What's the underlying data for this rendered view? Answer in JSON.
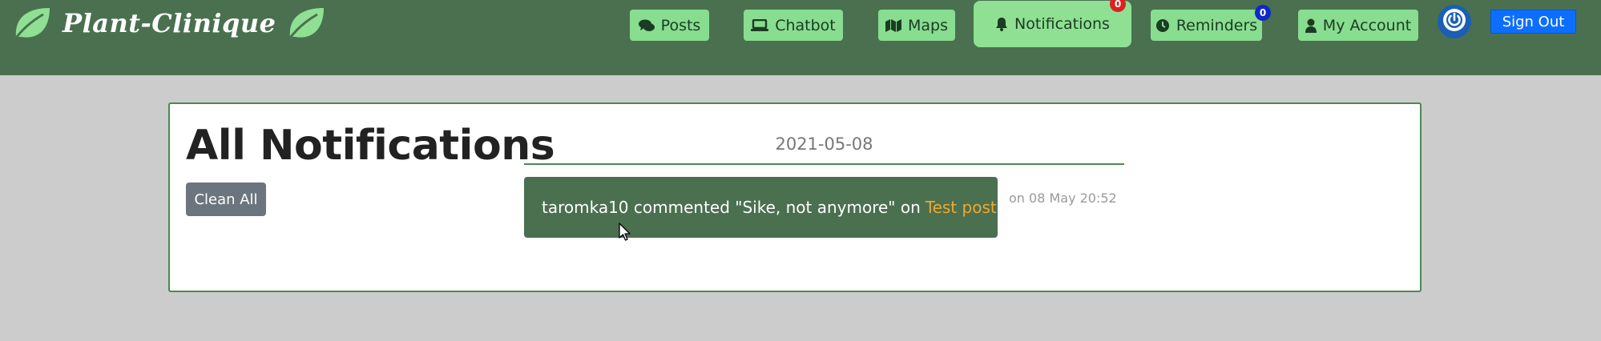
{
  "brand": {
    "name": "Plant-Clinique",
    "icons": [
      "leaf-icon",
      "leaf-icon"
    ]
  },
  "nav": {
    "posts": {
      "label": "Posts",
      "icon": "comments-icon"
    },
    "chatbot": {
      "label": "Chatbot",
      "icon": "laptop-icon"
    },
    "maps": {
      "label": "Maps",
      "icon": "map-icon"
    },
    "notifications": {
      "label": "Notifications",
      "icon": "bell-icon",
      "badge": "0"
    },
    "reminders": {
      "label": "Reminders",
      "icon": "clock-icon",
      "badge": "0"
    },
    "account": {
      "label": "My Account",
      "icon": "user-icon"
    },
    "power_icon": "power-icon",
    "sign_out": "Sign Out"
  },
  "page": {
    "title": "All Notifications",
    "clean_all": "Clean All"
  },
  "notifications": [
    {
      "date": "2021-05-08",
      "text": "taromka10 commented \"Sike, not anymore\" on",
      "link": "Test post",
      "time": "on 08 May 20:52"
    }
  ],
  "colors": {
    "navbar": "#4a7050",
    "nav_button": "#88dd90",
    "badge_red": "#e02020",
    "badge_blue": "#1028c8",
    "sign_out": "#0d6efd",
    "card_border": "#4a8a50",
    "link": "#f0a830",
    "background": "#cccccc"
  }
}
